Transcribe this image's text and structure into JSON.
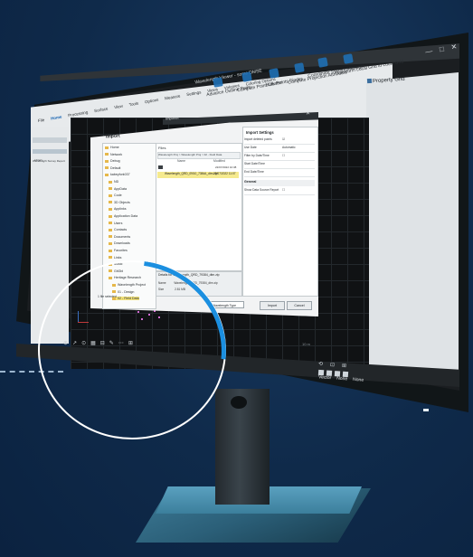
{
  "app": {
    "title": "Wavelength Viewer - some DMSE",
    "window_controls": [
      "—",
      "□",
      "✕"
    ]
  },
  "ribbon": {
    "tabs": [
      "File",
      "Home",
      "Processing",
      "Surface",
      "View",
      "Tools",
      "Options",
      "Measure",
      "Settings",
      "Views",
      "Volumes",
      "Coloring Options"
    ],
    "active_tab": "Home",
    "buttons": [
      {
        "label": "Advance Outline Point",
        "icon": "outline-icon"
      },
      {
        "label": "Compute Point Cluster",
        "icon": "cluster-icon"
      },
      {
        "label": "Bulk Points Finder",
        "icon": "points-icon"
      },
      {
        "label": "Compute Projection Attributes",
        "icon": "projection-icon"
      },
      {
        "label": "Coordinate System Manager",
        "icon": "coordinate-icon"
      },
      {
        "label": "Transform Local Grid to Local Grid",
        "icon": "transform-icon"
      }
    ]
  },
  "property_grid": {
    "title": "Property Grid"
  },
  "left_panel": {
    "tab": "Library",
    "item": "Wavelength Survey Report"
  },
  "viewport": {
    "scale_label": "10 m",
    "toolbar": [
      "⊕",
      "↗",
      "⊙",
      "▦",
      "⊟",
      "✎",
      "⋯",
      "⊞"
    ]
  },
  "status": {
    "nav_icons": [
      "⟲",
      "⊡",
      "⊞"
    ],
    "vector_label": "Vector",
    "none_label": "None",
    "geo_label": "None"
  },
  "dialog": {
    "title": "Importer",
    "heading": "Import",
    "close": "✕",
    "tree": [
      {
        "label": "Home",
        "selected": false
      },
      {
        "label": "Network",
        "selected": false
      },
      {
        "label": "Debug",
        "selected": false
      },
      {
        "label": "Default",
        "selected": false
      },
      {
        "label": "kabeyfork037",
        "selected": false
      },
      {
        "label": "ND",
        "selected": false
      },
      {
        "label": "AppData",
        "selected": false
      },
      {
        "label": "Code",
        "selected": false
      },
      {
        "label": "3D Objects",
        "selected": false
      },
      {
        "label": "Applinks",
        "selected": false
      },
      {
        "label": "Application Data",
        "selected": false
      },
      {
        "label": "Users",
        "selected": false
      },
      {
        "label": "Contacts",
        "selected": false
      },
      {
        "label": "Documents",
        "selected": false
      },
      {
        "label": "Downloads",
        "selected": false
      },
      {
        "label": "Favorites",
        "selected": false
      },
      {
        "label": "Links",
        "selected": false
      },
      {
        "label": "Music",
        "selected": false
      },
      {
        "label": "GitGbl",
        "selected": false
      },
      {
        "label": "Heritage Research",
        "selected": false
      },
      {
        "label": "Wavelength Project",
        "selected": false
      },
      {
        "label": "01 - Design",
        "selected": false
      },
      {
        "label": "02 - Field Data",
        "selected": true
      }
    ],
    "files": {
      "header": "Files",
      "path": "Wavelength Proj > Wavelength Proj > 02 - Field Data",
      "columns": [
        "Name",
        "Modified"
      ],
      "folder_date": "22/07/2022 10:38",
      "rows": [
        {
          "name": "Wavelength_QRD_09/10_7384A_dtm.zip",
          "modified": "22/07/2022 11:07"
        }
      ]
    },
    "details": {
      "title": "Details for Wavelength_QRD_79384_dtm.zip",
      "rows": [
        {
          "label": "Name",
          "value": "Wavelength_QRD_79384_dtm.zip"
        },
        {
          "label": "Size",
          "value": "2.81 MB"
        }
      ]
    },
    "settings": {
      "heading": "Import Settings",
      "rows": [
        {
          "label": "Import deleted points",
          "value": "☑"
        },
        {
          "label": "Use Date",
          "value": "Automatic"
        },
        {
          "label": "Filter by Date/Time",
          "value": "☐"
        },
        {
          "label": "Start Date/Time",
          "value": ""
        },
        {
          "label": "End Date/Time",
          "value": ""
        }
      ],
      "general_heading": "General",
      "general_rows": [
        {
          "label": "Show Data Source Report",
          "value": "☐"
        }
      ]
    },
    "files_selected": "1 file selected",
    "file_type": "Wavelength Type",
    "import_button": "Import",
    "cancel_button": "Cancel"
  }
}
